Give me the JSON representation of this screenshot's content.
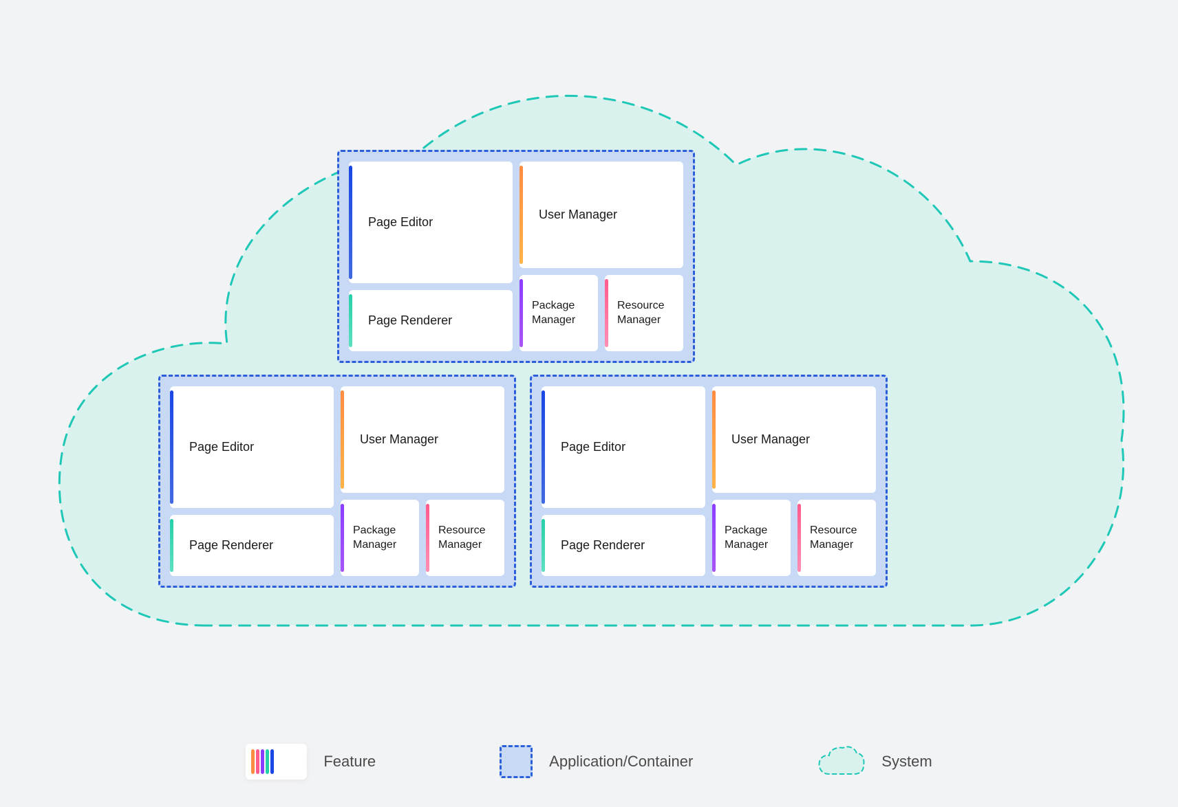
{
  "features": {
    "page_editor": "Page Editor",
    "page_renderer": "Page Renderer",
    "user_manager": "User Manager",
    "package_manager": "Package Manager",
    "package_manager_line1": "Package",
    "package_manager_line2": "Manager",
    "resource_manager": "Resource Manager",
    "resource_manager_line1": "Resource",
    "resource_manager_line2": "Manager"
  },
  "legend": {
    "feature": "Feature",
    "container": "Application/Container",
    "system": "System"
  },
  "colors": {
    "cloud_fill": "#d9f2ee",
    "cloud_stroke": "#1fc7b6",
    "container_fill": "#c8d9f5",
    "container_stroke": "#2b5fd9",
    "feature_bg": "#ffffff",
    "page_bg": "#f2f3f5",
    "stripe_blue": "#1947e5",
    "stripe_orange": "#ff8c42",
    "stripe_teal": "#26d0a8",
    "stripe_purple": "#8b3dff",
    "stripe_pink": "#ff5a8c"
  }
}
